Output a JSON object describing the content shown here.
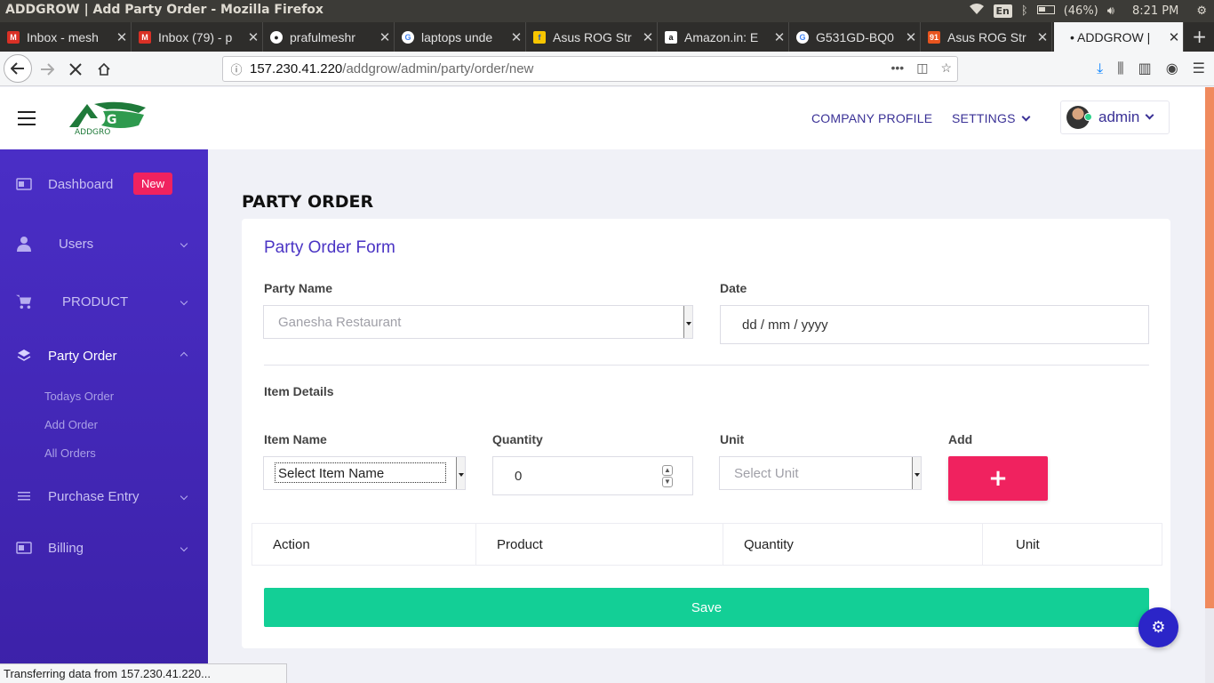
{
  "os": {
    "window_title": "ADDGROW | Add Party Order - Mozilla Firefox",
    "lang": "En",
    "battery": "(46%)",
    "time": "8:21 PM"
  },
  "browser": {
    "tabs": [
      {
        "label": "Inbox - mesh",
        "fav_color": "#d93025",
        "fav_char": "M"
      },
      {
        "label": "Inbox (79) - p",
        "fav_color": "#d93025",
        "fav_char": "M"
      },
      {
        "label": "prafulmeshr",
        "fav_color": "#222222",
        "fav_char": "●"
      },
      {
        "label": "laptops unde",
        "fav_color": "#4285f4",
        "fav_char": "G"
      },
      {
        "label": "Asus ROG Str",
        "fav_color": "#f7c600",
        "fav_char": "f"
      },
      {
        "label": "Amazon.in: E",
        "fav_color": "#111111",
        "fav_char": "a"
      },
      {
        "label": "G531GD-BQ0",
        "fav_color": "#4285f4",
        "fav_char": "G"
      },
      {
        "label": "Asus ROG Str",
        "fav_color": "#e8541e",
        "fav_char": "91"
      },
      {
        "label": "• ADDGROW |",
        "fav_color": "",
        "fav_char": ""
      }
    ],
    "url_host": "157.230.41.220",
    "url_path": "/addgrow/admin/party/order/new",
    "status_text": "Transferring data from 157.230.41.220..."
  },
  "header": {
    "company_profile": "COMPANY PROFILE",
    "settings": "SETTINGS",
    "user": "admin",
    "logo_text": "ADDGRO"
  },
  "sidebar": {
    "dashboard": "Dashboard",
    "new_badge": "New",
    "users": "Users",
    "product": "PRODUCT",
    "party_order": "Party Order",
    "sub_items": [
      "Todays Order",
      "Add Order",
      "All Orders"
    ],
    "purchase_entry": "Purchase Entry",
    "billing": "Billing"
  },
  "main": {
    "page_title": "PARTY ORDER",
    "form_title": "Party Order Form",
    "party_name_label": "Party Name",
    "party_name_value": "Ganesha Restaurant",
    "date_label": "Date",
    "date_placeholder": "dd / mm / yyyy",
    "item_details": "Item Details",
    "item_name_label": "Item Name",
    "item_name_value": "Select Item Name",
    "quantity_label": "Quantity",
    "quantity_value": "0",
    "unit_label": "Unit",
    "unit_value": "Select Unit",
    "add_label": "Add",
    "add_button": "+",
    "table_headers": [
      "Action",
      "Product",
      "Quantity",
      "Unit"
    ],
    "save_button": "Save"
  },
  "colors": {
    "sidebar": "#4a2ec6",
    "accent_pink": "#f0225f",
    "save_green": "#13cf96",
    "brand_purple": "#3a3196",
    "fab_blue": "#2b25c8"
  }
}
